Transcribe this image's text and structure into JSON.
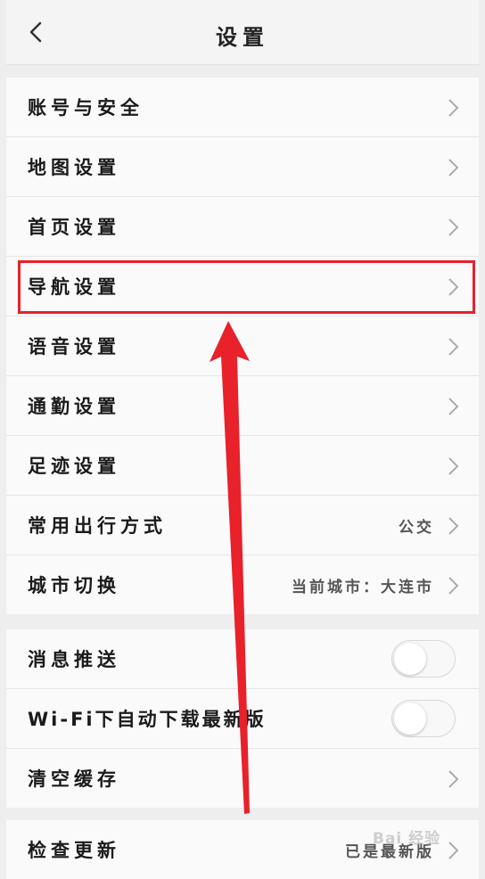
{
  "header": {
    "title": "设置"
  },
  "group1": [
    {
      "label": "账号与安全",
      "value": ""
    },
    {
      "label": "地图设置",
      "value": ""
    },
    {
      "label": "首页设置",
      "value": ""
    },
    {
      "label": "导航设置",
      "value": ""
    },
    {
      "label": "语音设置",
      "value": ""
    },
    {
      "label": "通勤设置",
      "value": ""
    },
    {
      "label": "足迹设置",
      "value": ""
    },
    {
      "label": "常用出行方式",
      "value": "公交"
    },
    {
      "label": "城市切换",
      "value": "当前城市：大连市"
    }
  ],
  "group2": [
    {
      "label": "消息推送",
      "toggle": false
    },
    {
      "label": "Wi-Fi下自动下载最新版",
      "toggle": false
    },
    {
      "label": "清空缓存"
    }
  ],
  "group3": [
    {
      "label": "检查更新",
      "value": "已是最新版"
    }
  ],
  "annotation": {
    "highlight_color": "#e8212b"
  },
  "watermark": "Bai 经验"
}
